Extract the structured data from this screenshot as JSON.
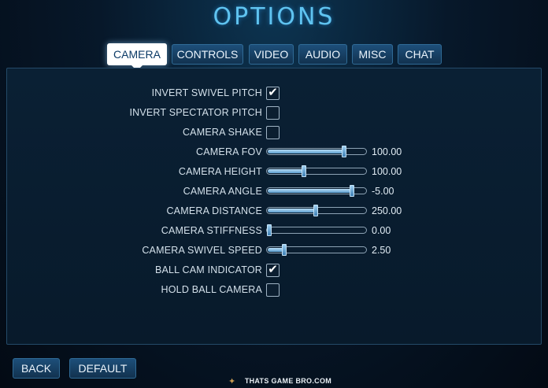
{
  "title": "OPTIONS",
  "tabs": [
    {
      "label": "CAMERA",
      "active": true
    },
    {
      "label": "CONTROLS",
      "active": false
    },
    {
      "label": "VIDEO",
      "active": false
    },
    {
      "label": "AUDIO",
      "active": false
    },
    {
      "label": "MISC",
      "active": false
    },
    {
      "label": "CHAT",
      "active": false
    }
  ],
  "settings": {
    "invert_swivel_pitch": {
      "label": "INVERT SWIVEL PITCH",
      "checked": true
    },
    "invert_spectator_pitch": {
      "label": "INVERT SPECTATOR PITCH",
      "checked": false
    },
    "camera_shake": {
      "label": "CAMERA SHAKE",
      "checked": false
    },
    "camera_fov": {
      "label": "CAMERA FOV",
      "value": "100.00",
      "level": 0.79
    },
    "camera_height": {
      "label": "CAMERA HEIGHT",
      "value": "100.00",
      "level": 0.37
    },
    "camera_angle": {
      "label": "CAMERA ANGLE",
      "value": "-5.00",
      "level": 0.87
    },
    "camera_distance": {
      "label": "CAMERA DISTANCE",
      "value": "250.00",
      "level": 0.49
    },
    "camera_stiffness": {
      "label": "CAMERA STIFFNESS",
      "value": "0.00",
      "level": 0.0
    },
    "camera_swivel_speed": {
      "label": "CAMERA SWIVEL SPEED",
      "value": "2.50",
      "level": 0.16
    },
    "ball_cam_indicator": {
      "label": "BALL CAM INDICATOR",
      "checked": true
    },
    "hold_ball_camera": {
      "label": "HOLD BALL CAMERA",
      "checked": false
    }
  },
  "footer": {
    "back_label": "BACK",
    "default_label": "DEFAULT",
    "watermark": "THATS GAME BRO.COM"
  },
  "colors": {
    "accent": "#5fc3f0",
    "button_bg": "#1d4f7a",
    "active_tab_bg": "#ffffff",
    "panel_bg": "#0a2034"
  },
  "icons": {
    "check": "check-icon",
    "watermark_logo": "watermark-logo-icon"
  }
}
